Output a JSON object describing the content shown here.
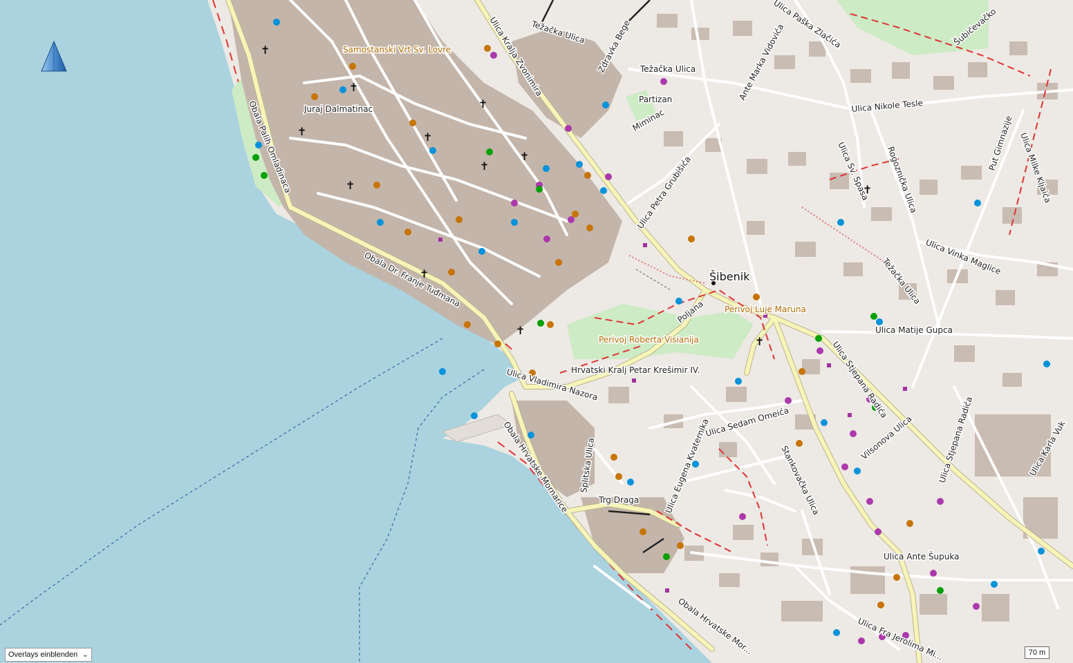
{
  "map": {
    "city_label": "Šibenik",
    "streets": {
      "obala_palih": "Obala Palih Omladinaca",
      "obala_tudmana": "Obala Dr. Franje Tuđmana",
      "vladimira_nazora": "Ulica Vladimira Nazora",
      "obala_hrvatske_mornarice": "Obala Hrvatske Mornarice",
      "obala_hrvatske_mor_bottom": "Obala Hrvatske Mor...",
      "kralja_zvonimira": "Ulica Kralja Zvonimira",
      "tezacka_top": "Težačka Ulica",
      "tezacka_mid": "Težačka Ulica",
      "zdravka_bege": "Zdravka Bege",
      "paska_zlacica": "Ulica Paška Zlačića",
      "ante_marka_vidovica": "Ante Marka Vidovića",
      "nikole_tesle": "Ulica Nikole Tesle",
      "sv_spasa": "Ulica Sv. Spasa",
      "rogoznicka": "Rogoznička Ulica",
      "put_gimnazije": "Put Gimnazije",
      "milke_kljaica": "Ulica Milke Kljaića",
      "subicevacko": "Šubićevačko",
      "vinka_maglice": "Ulica Vinka Maglice",
      "tezacka_ulica_diag": "Težačka Ulica",
      "matije_gupca": "Ulica Matije Gupca",
      "stjepana_radica": "Ulica Stjepana Radića",
      "stjepana_radica_2": "Ulica Stjepana Radića",
      "vilsonova": "Vilsonova Ulica",
      "karla_vuk": "Ulica Karla Vuk",
      "petra_grubisica": "Ulica Petra Grubišića",
      "poljana": "Poljana",
      "hrvatski_kralj": "Hrvatski Kralj Petar Krešimir IV.",
      "sedam_omeica": "Ulica Sedam Omeića",
      "stankovacka": "Stankovačka Ulica",
      "eugena_kvaternika": "Ulica Eugena Kvaternika",
      "splitska": "Splitska Ulica",
      "trg_draga": "Trg Draga",
      "ante_supuka": "Ulica Ante Šupuka",
      "jerolima_mi": "Ulica Fra Jerolima Mi..."
    },
    "pois": {
      "samostanski_vrt": "Samostanski Vrt Sv. Lovre",
      "juraj_dalmatinac": "Juraj Dalmatinac",
      "partizan": "Partizan",
      "miminac": "Miminac",
      "perivoj_luje": "Perivoj Luje Maruna",
      "perivoj_roberta": "Perivoj Roberta Visianija"
    }
  },
  "overlay_control": {
    "label": "Overlays einblenden",
    "chevron_icon": "chevron-down-icon"
  },
  "scale_bar": {
    "label": "70 m"
  },
  "colors": {
    "water": "#aad3df",
    "building": "#c9bcb3",
    "road": "#ffffff",
    "major_road": "#f7f4b8",
    "park": "#c8e8c0",
    "boundary_dash": "#e03333",
    "poi_food": "#c77400",
    "poi_shop": "#ac39ac",
    "poi_transport": "#0092da",
    "poi_health": "#00a000"
  }
}
